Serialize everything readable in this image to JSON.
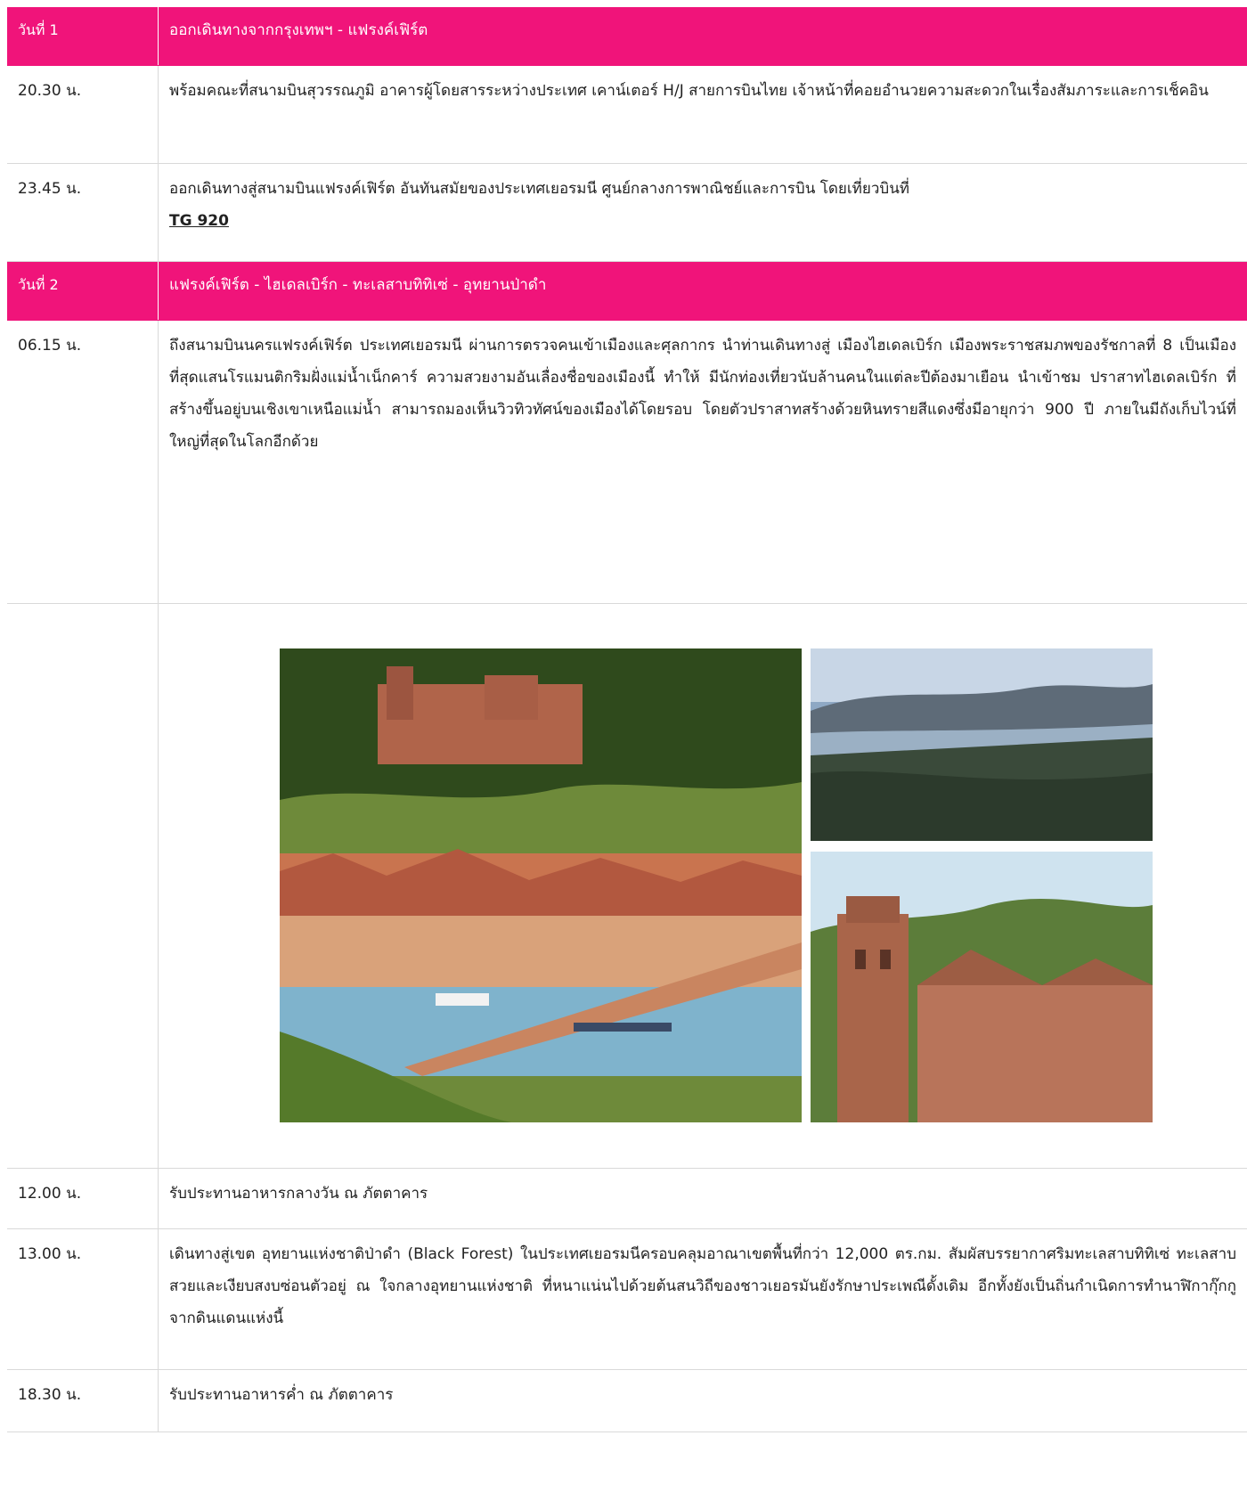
{
  "days": [
    {
      "day_label": "วันที่ 1",
      "day_title": "ออกเดินทางจากกรุงเทพฯ - แฟรงค์เฟิร์ต",
      "rows": [
        {
          "time": "20.30 น.",
          "text": "พร้อมคณะที่สนามบินสุวรรณภูมิ อาคารผู้โดยสารระหว่างประเทศ เคาน์เตอร์ H/J สายการบินไทย เจ้าหน้าที่คอยอำนวยความสะดวกในเรื่องสัมภาระและการเช็คอิน"
        },
        {
          "time": "23.45 น.",
          "text": "ออกเดินทางสู่สนามบินแฟรงค์เฟิร์ต อันทันสมัยของประเทศเยอรมนี ศูนย์กลางการพาณิชย์และการบิน โดยเที่ยวบินที่",
          "flight": "TG 920"
        }
      ]
    },
    {
      "day_label": "วันที่ 2",
      "day_title": "แฟรงค์เฟิร์ต - ไฮเดลเบิร์ก - ทะเลสาบทิทิเซ่ - อุทยานป่าดำ",
      "rows": [
        {
          "time": "06.15 น.",
          "text": "ถึงสนามบินนครแฟรงค์เฟิร์ต ประเทศเยอรมนี ผ่านการตรวจคนเข้าเมืองและศุลกากร นำท่านเดินทางสู่ เมืองไฮเดลเบิร์ก เมืองพระราชสมภพของรัชกาลที่ 8 เป็นเมืองที่สุดแสนโรแมนติกริมฝั่งแม่น้ำเน็กคาร์ ความสวยงามอันเลื่องชื่อของเมืองนี้ ทำให้ มีนักท่องเที่ยวนับล้านคนในแต่ละปีต้องมาเยือน นำเข้าชม ปราสาทไฮเดลเบิร์ก ที่สร้างขึ้นอยู่บนเชิงเขาเหนือแม่น้ำ สามารถมองเห็นวิวทิวทัศน์ของเมืองได้โดยรอบ โดยตัวปราสาทสร้างด้วยหินทรายสีแดงซึ่งมีอายุกว่า 900 ปี ภายในมีถังเก็บไวน์ที่ใหญ่ที่สุดในโลกอีกด้วย"
        },
        {
          "time": "12.00 น.",
          "text": "รับประทานอาหารกลางวัน ณ ภัตตาคาร"
        },
        {
          "time": "13.00 น.",
          "text": "เดินทางสู่เขต อุทยานแห่งชาติป่าดำ (Black Forest) ในประเทศเยอรมนีครอบคลุมอาณาเขตพื้นที่กว่า 12,000 ตร.กม. สัมผัสบรรยากาศริมทะเลสาบทิทิเซ่ ทะเลสาบสวยและเงียบสงบซ่อนตัวอยู่ ณ ใจกลางอุทยานแห่งชาติ ที่หนาแน่นไปด้วยต้นสนวิถีของชาวเยอรมันยังรักษาประเพณีดั้งเดิม อีกทั้งยังเป็นถิ่นกำเนิดการทำนาฬิกากุ๊กกูจากดินแดนแห่งนี้"
        },
        {
          "time": "18.30 น.",
          "text": "รับประทานอาหารค่ำ ณ ภัตตาคาร"
        }
      ]
    }
  ],
  "colors": {
    "day_header": "#f0147a",
    "border": "#d9d9d9"
  },
  "photos": [
    "heidelberg-city-bridge-photo",
    "titisee-lake-photo",
    "heidelberg-castle-tower-photo"
  ]
}
